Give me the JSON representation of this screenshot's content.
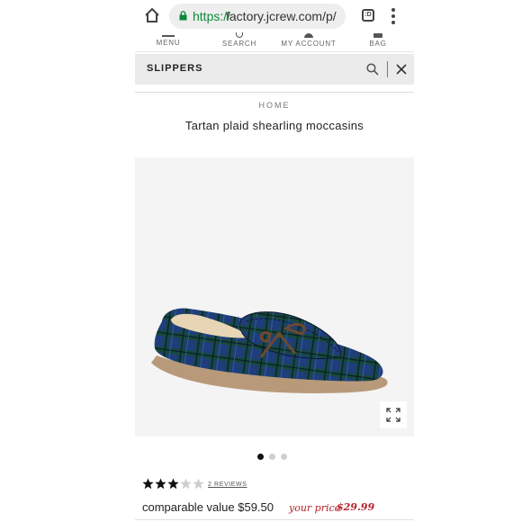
{
  "browser": {
    "url_scheme": "https://",
    "url_rest": "factory.jcrew.com/p/",
    "tabs_count": ":D",
    "icons": [
      "home-icon",
      "lock-icon",
      "tabs-icon",
      "more-vert-icon"
    ]
  },
  "nav": {
    "menu": "MENU",
    "search": "SEARCH",
    "account": "MY ACCOUNT",
    "bag": "BAG"
  },
  "search": {
    "value": "SLIPPERS",
    "icons": [
      "search-icon",
      "close-icon"
    ]
  },
  "breadcrumb": "HOME",
  "product": {
    "title": "Tartan plaid shearling moccasins",
    "image_icon": "expand-icon",
    "image_pages": 3,
    "image_current_page": 1,
    "rating": {
      "value": 3,
      "max": 5
    },
    "reviews_label": "2 REVIEWS",
    "comparable_value": "comparable value $59.50",
    "your_price_label": "your price",
    "your_price": "$29.99"
  },
  "colors": {
    "secure_green": "#0b8a3a",
    "sale_red": "#b8202b",
    "star_filled": "#111111",
    "star_empty": "#cfcfcf"
  }
}
